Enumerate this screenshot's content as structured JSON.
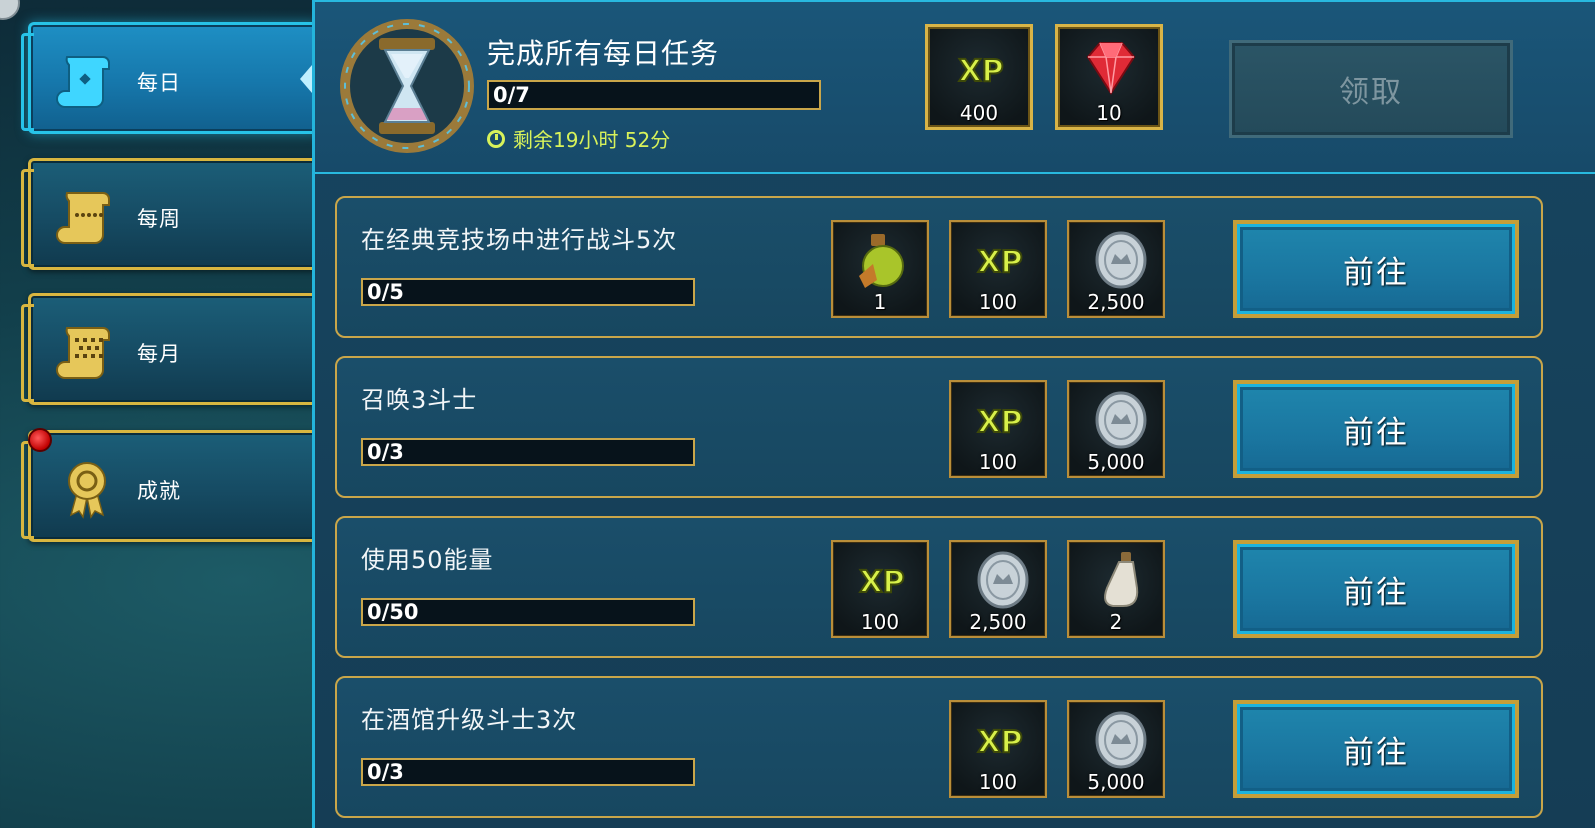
{
  "sidebar": {
    "tabs": [
      {
        "label": "每日",
        "active": true
      },
      {
        "label": "每周",
        "active": false
      },
      {
        "label": "每月",
        "active": false
      },
      {
        "label": "成就",
        "active": false
      }
    ]
  },
  "header": {
    "title": "完成所有每日任务",
    "progress": "0/7",
    "timer": "剩余19小时 52分",
    "rewards": [
      {
        "icon": "xp-icon",
        "qty": "400"
      },
      {
        "icon": "ruby-gem-icon",
        "qty": "10"
      }
    ],
    "claim_label": "领取"
  },
  "quests": [
    {
      "title": "在经典竞技场中进行战斗5次",
      "progress": "0/5",
      "rewards": [
        {
          "icon": "potion-icon",
          "qty": "1"
        },
        {
          "icon": "xp-icon",
          "qty": "100"
        },
        {
          "icon": "silver-coin-icon",
          "qty": "2,500"
        }
      ],
      "button_label": "前往"
    },
    {
      "title": "召唤3斗士",
      "progress": "0/3",
      "rewards": [
        {
          "icon": "xp-icon",
          "qty": "100"
        },
        {
          "icon": "silver-coin-icon",
          "qty": "5,000"
        }
      ],
      "button_label": "前往"
    },
    {
      "title": "使用50能量",
      "progress": "0/50",
      "rewards": [
        {
          "icon": "xp-icon",
          "qty": "100"
        },
        {
          "icon": "silver-coin-icon",
          "qty": "2,500"
        },
        {
          "icon": "flask-icon",
          "qty": "2"
        }
      ],
      "button_label": "前往"
    },
    {
      "title": "在酒馆升级斗士3次",
      "progress": "0/3",
      "rewards": [
        {
          "icon": "xp-icon",
          "qty": "100"
        },
        {
          "icon": "silver-coin-icon",
          "qty": "5,000"
        }
      ],
      "button_label": "前往"
    }
  ],
  "colors": {
    "accent_cyan": "#27c3e8",
    "gold_border": "#c9a64a",
    "timer_green": "#d8f25a"
  }
}
